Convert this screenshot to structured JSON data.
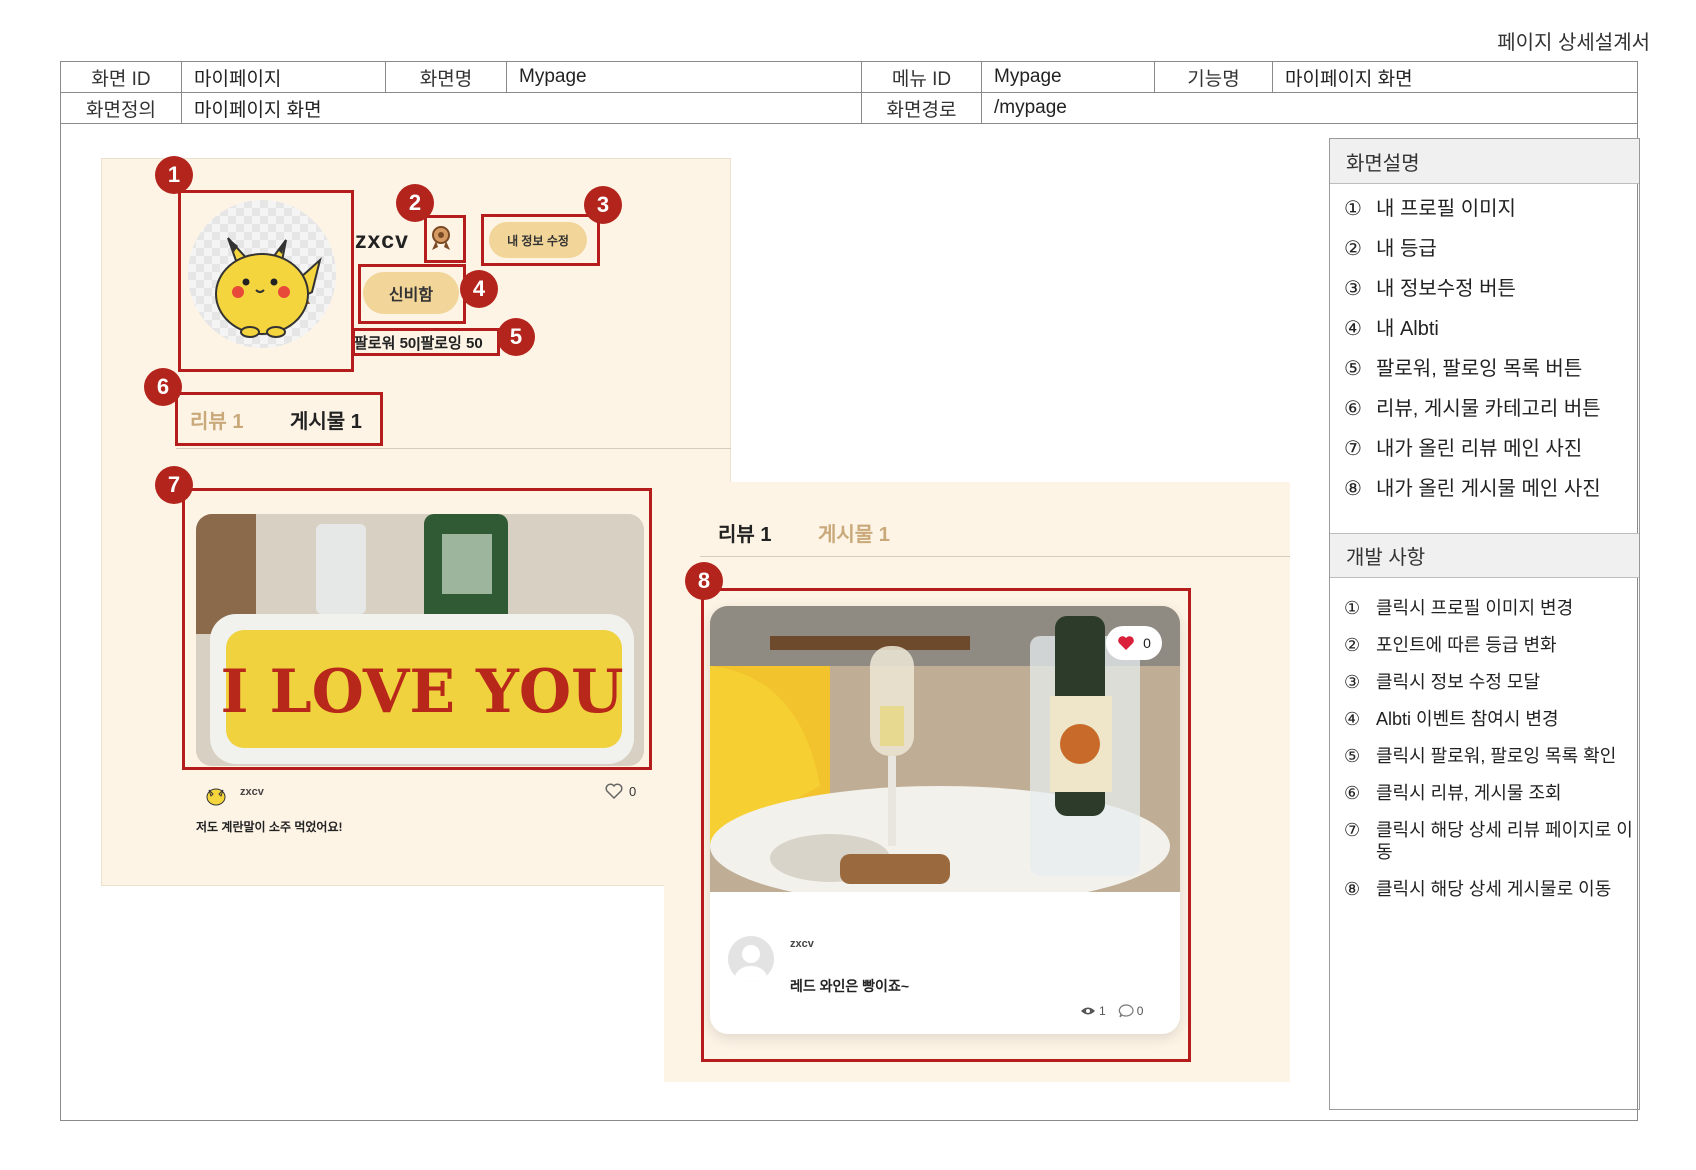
{
  "doc_title": "페이지 상세설계서",
  "header": {
    "screen_id_label": "화면 ID",
    "screen_id": "마이페이지",
    "screen_name_label": "화면명",
    "screen_name": "Mypage",
    "menu_id_label": "메뉴 ID",
    "menu_id": "Mypage",
    "function_label": "기능명",
    "function_name": "마이페이지 화면",
    "definition_label": "화면정의",
    "definition": "마이페이지 화면",
    "path_label": "화면경로",
    "path": "/mypage"
  },
  "mockup": {
    "username": "zxcv",
    "edit_button": "내 정보 수정",
    "albti_button": "신비함",
    "follow_text": "팔로워 50|팔로잉 50",
    "tab_review": "리뷰 1",
    "tab_post": "게시물 1",
    "review_photo_text": "I LOVE YOU",
    "review_user": "zxcv",
    "review_likes": "0",
    "review_caption": "저도 계란말이 소주 먹었어요!",
    "post_likes": "0",
    "post_user": "zxcv",
    "post_caption": "레드 와인은 빵이죠~",
    "post_views": "1",
    "post_comments": "0"
  },
  "markers": [
    "1",
    "2",
    "3",
    "4",
    "5",
    "6",
    "7",
    "8"
  ],
  "side": {
    "screen_desc_title": "화면설명",
    "screen_desc": [
      {
        "mark": "①",
        "text": "내 프로필 이미지"
      },
      {
        "mark": "②",
        "text": "내 등급"
      },
      {
        "mark": "③",
        "text": "내 정보수정 버튼"
      },
      {
        "mark": "④",
        "text": "내 Albti"
      },
      {
        "mark": "⑤",
        "text": "팔로워, 팔로잉 목록 버튼"
      },
      {
        "mark": "⑥",
        "text": "리뷰, 게시물 카테고리 버튼"
      },
      {
        "mark": "⑦",
        "text": "내가 올린 리뷰 메인 사진"
      },
      {
        "mark": "⑧",
        "text": "내가 올린 게시물 메인 사진"
      }
    ],
    "dev_title": "개발 사항",
    "dev_items": [
      {
        "mark": "①",
        "text": "클릭시 프로필 이미지 변경"
      },
      {
        "mark": "②",
        "text": "포인트에 따른 등급 변화"
      },
      {
        "mark": "③",
        "text": "클릭시 정보 수정 모달"
      },
      {
        "mark": "④",
        "text": "Albti 이벤트 참여시 변경"
      },
      {
        "mark": "⑤",
        "text": "클릭시 팔로워, 팔로잉 목록 확인"
      },
      {
        "mark": "⑥",
        "text": "클릭시 리뷰, 게시물 조회"
      },
      {
        "mark": "⑦",
        "text": "클릭시 해당 상세 리뷰 페이지로 이동"
      },
      {
        "mark": "⑧",
        "text": "클릭시 해당 상세 게시물로 이동"
      }
    ]
  },
  "colors": {
    "annotation_red": "#b51d1d",
    "mockup_bg": "#fdf4e6",
    "button_fill": "#f2d598",
    "tab_inactive": "#c9a97a"
  }
}
